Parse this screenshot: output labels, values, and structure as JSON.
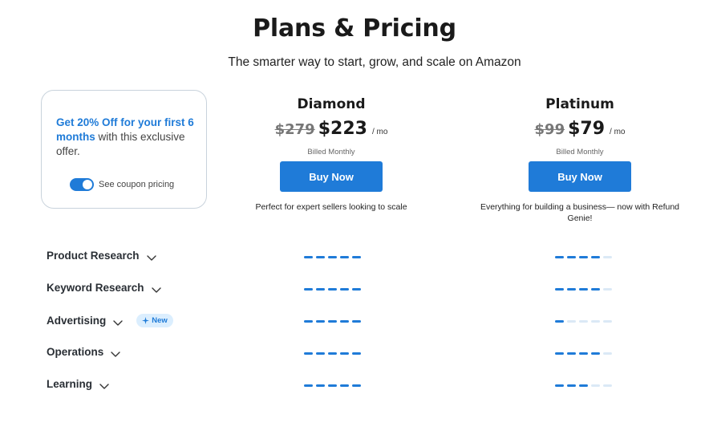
{
  "header": {
    "title": "Plans & Pricing",
    "subtitle": "The smarter way to start, grow, and scale on Amazon"
  },
  "offer": {
    "highlight": "Get 20% Off for your first 6 months",
    "rest": " with this exclusive offer.",
    "coupon_label": "See coupon pricing",
    "coupon_enabled": true
  },
  "plans": [
    {
      "name": "Diamond",
      "old_price": "$279",
      "price": "$223",
      "per": "/ mo",
      "billed": "Billed Monthly",
      "button": "Buy Now",
      "description": "Perfect for expert sellers looking to scale"
    },
    {
      "name": "Platinum",
      "old_price": "$99",
      "price": "$79",
      "per": "/ mo",
      "billed": "Billed Monthly",
      "button": "Buy Now",
      "description": "Everything for building a business— now with Refund Genie!"
    }
  ],
  "features": [
    {
      "name": "Product Research",
      "diamond": 5,
      "platinum": 4,
      "max": 5,
      "badge": ""
    },
    {
      "name": "Keyword Research",
      "diamond": 5,
      "platinum": 4,
      "max": 5,
      "badge": ""
    },
    {
      "name": "Advertising",
      "diamond": 5,
      "platinum": 1,
      "max": 5,
      "badge": "New"
    },
    {
      "name": "Operations",
      "diamond": 5,
      "platinum": 4,
      "max": 5,
      "badge": ""
    },
    {
      "name": "Learning",
      "diamond": 5,
      "platinum": 3,
      "max": 5,
      "badge": ""
    }
  ],
  "colors": {
    "accent": "#1f7bd8",
    "bar_off": "#dbe9f6",
    "badge_bg": "#dbeefe"
  }
}
